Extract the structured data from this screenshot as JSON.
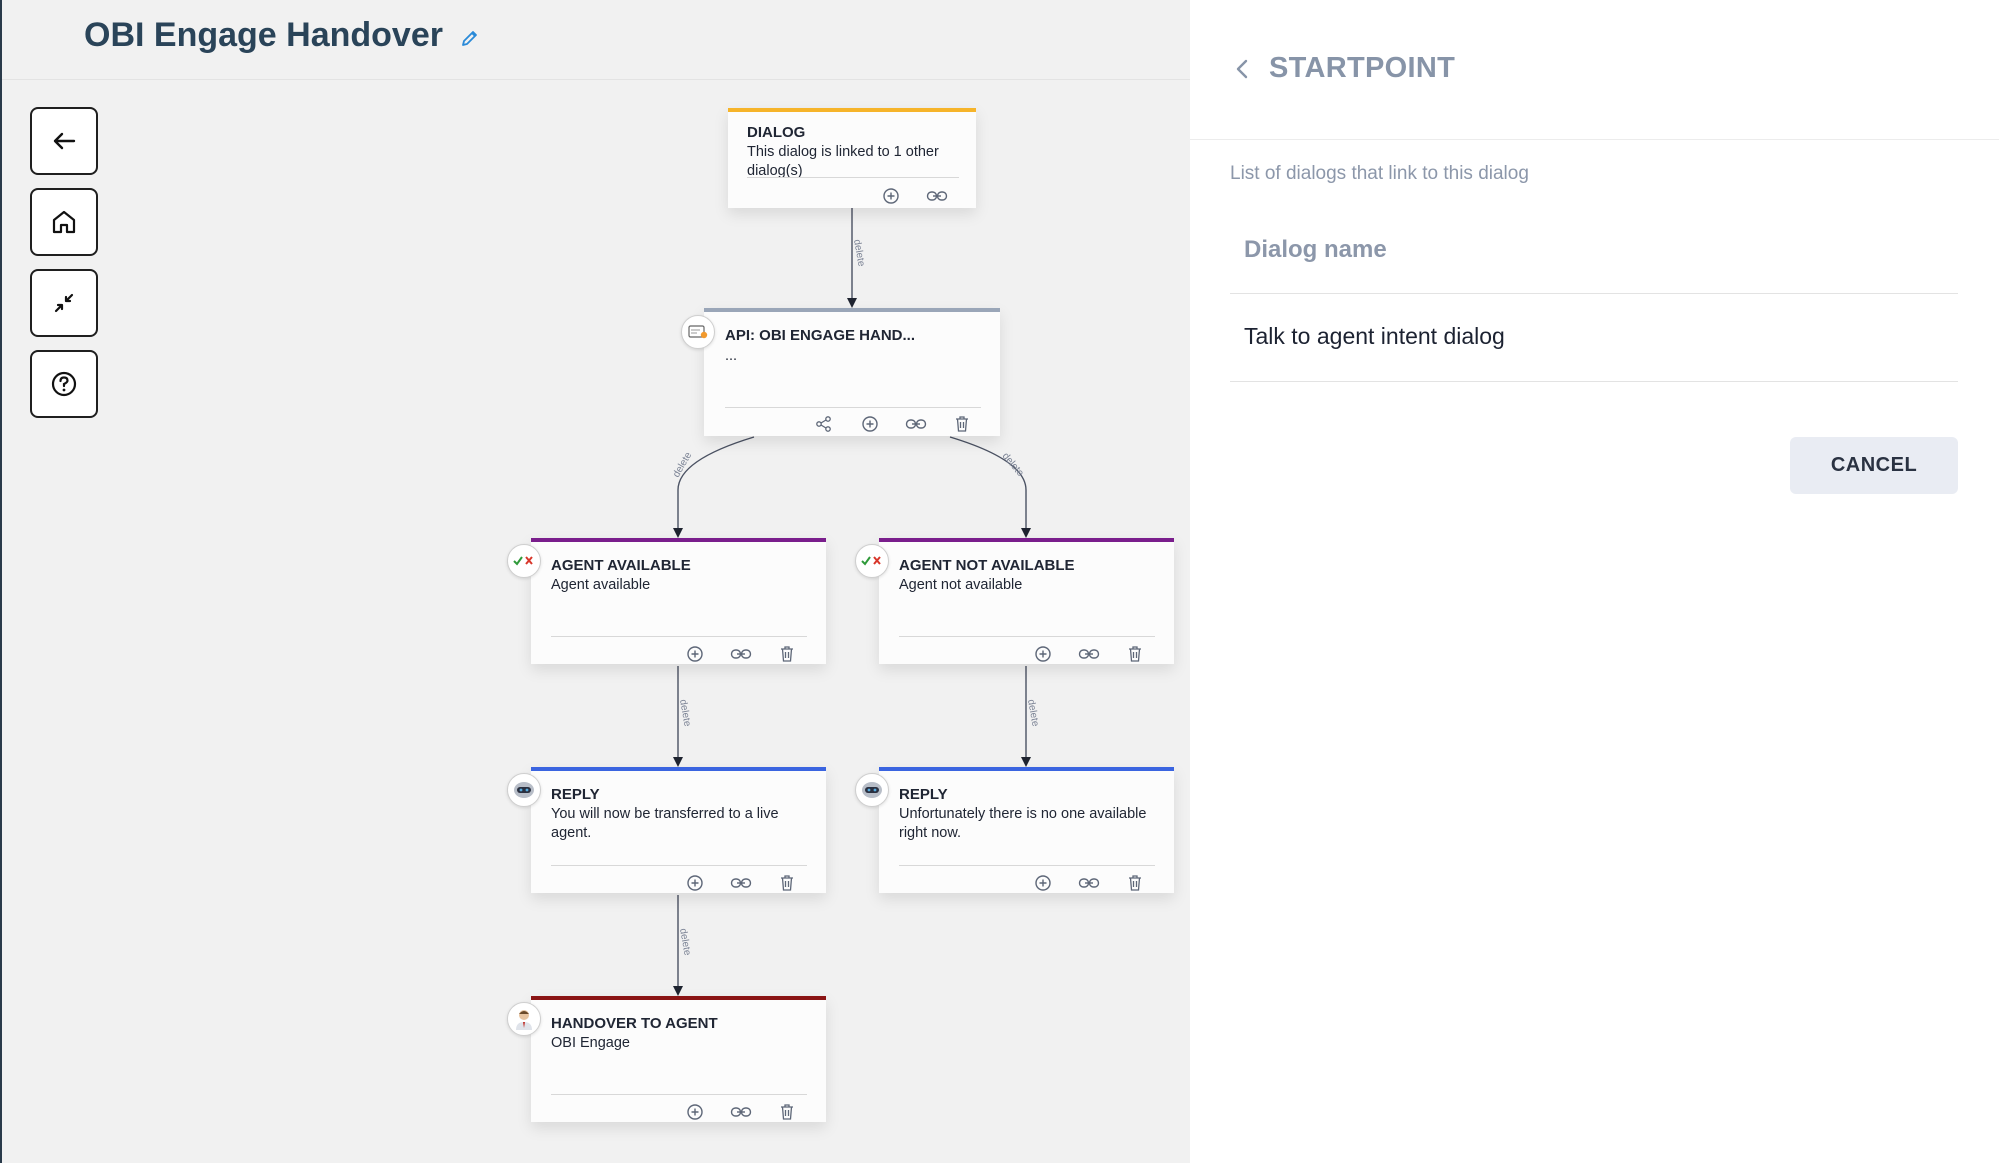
{
  "header": {
    "title": "OBI Engage Handover",
    "edit_icon": "pencil-icon"
  },
  "toolbar": [
    {
      "name": "back-button",
      "icon": "arrow-left-icon"
    },
    {
      "name": "home-button",
      "icon": "home-icon"
    },
    {
      "name": "collapse-button",
      "icon": "collapse-icon"
    },
    {
      "name": "help-button",
      "icon": "help-circle-icon"
    }
  ],
  "link_label": "delete",
  "colors": {
    "dialog": "#f6b42a",
    "api": "#9aa6b8",
    "condition": "#7a1e8c",
    "reply": "#3a64e0",
    "handover": "#8a1414",
    "accent": "#2a8ad8"
  },
  "nodes": {
    "dialog": {
      "title": "DIALOG",
      "text": "This dialog is linked to 1 other dialog(s)"
    },
    "api": {
      "title": "API: OBI ENGAGE HAND...",
      "text": "..."
    },
    "agent_available": {
      "title": "AGENT AVAILABLE",
      "text": "Agent available"
    },
    "agent_not_available": {
      "title": "AGENT NOT AVAILABLE",
      "text": "Agent not available"
    },
    "reply_left": {
      "title": "REPLY",
      "text": "You will now be transferred to a live agent."
    },
    "reply_right": {
      "title": "REPLY",
      "text": "Unfortunately there is no one available right now."
    },
    "handover": {
      "title": "HANDOVER TO AGENT",
      "text": "OBI Engage"
    }
  },
  "panel": {
    "title": "STARTPOINT",
    "description": "List of dialogs that link to this dialog",
    "column_header": "Dialog name",
    "rows": [
      "Talk to agent intent dialog"
    ],
    "cancel_label": "CANCEL"
  }
}
